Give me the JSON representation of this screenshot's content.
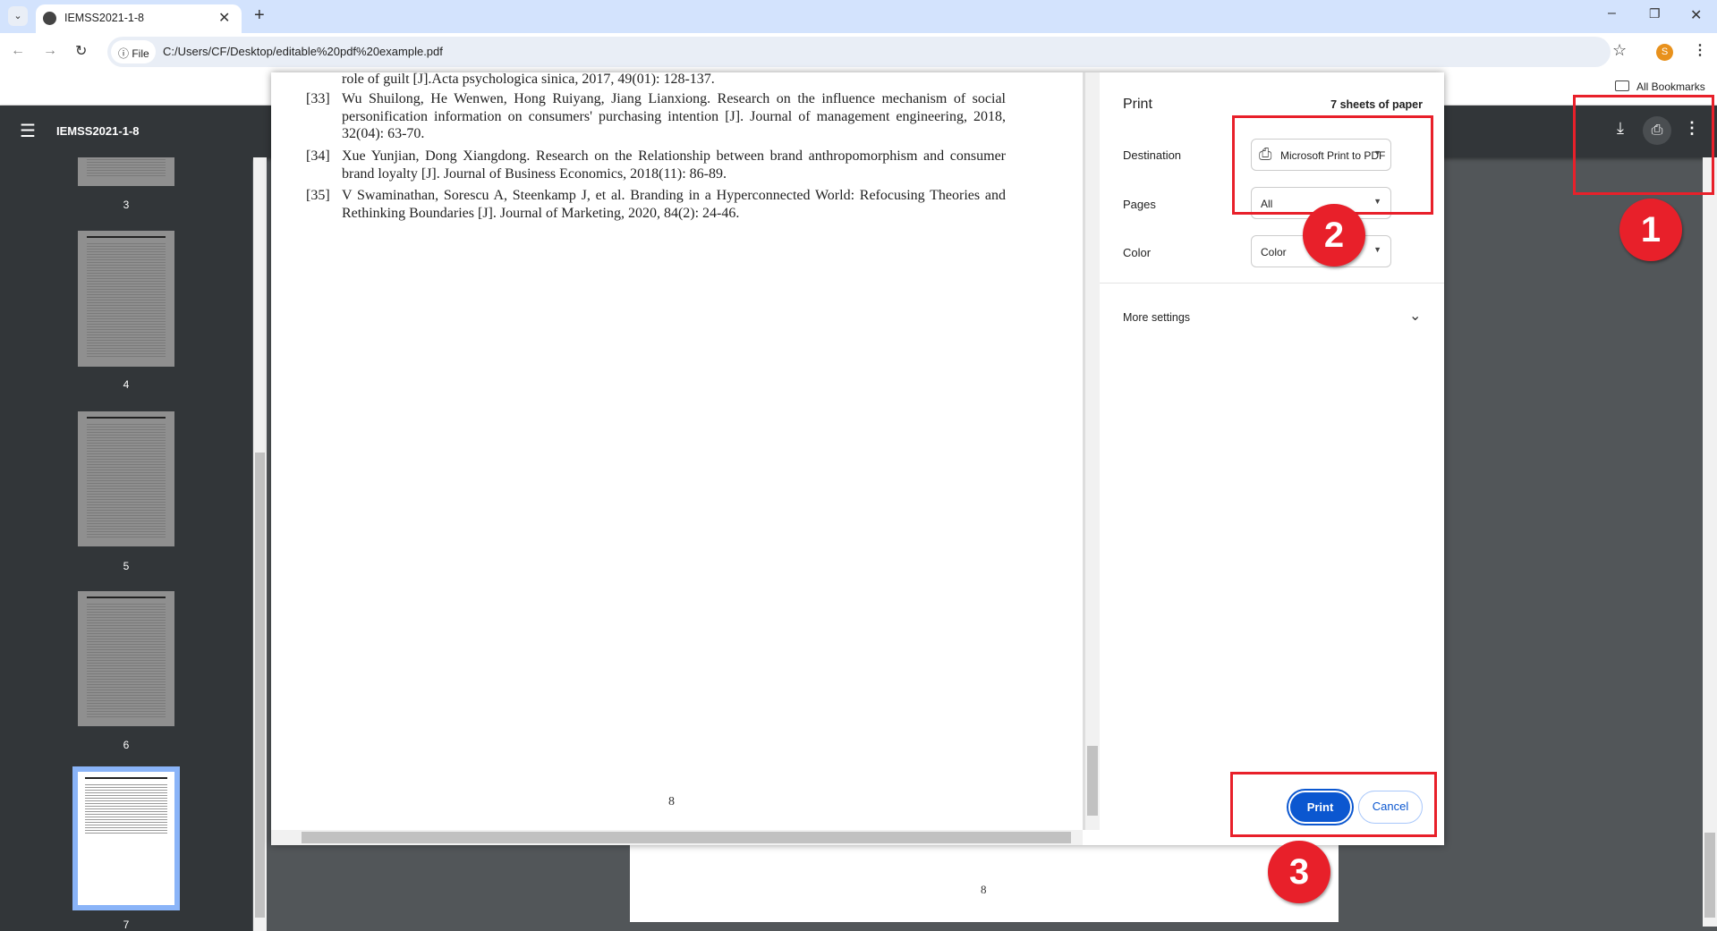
{
  "browser": {
    "tab_title": "IEMSS2021-1-8",
    "url_chip": "File",
    "url": "C:/Users/CF/Desktop/editable%20pdf%20example.pdf",
    "bookmarks_label": "All Bookmarks",
    "profile_initial": "S"
  },
  "viewer": {
    "title": "IEMSS2021-1-8",
    "thumbnails": [
      "3",
      "4",
      "5",
      "6",
      "7"
    ],
    "selected_page": "7",
    "page_number": "8"
  },
  "preview": {
    "references": [
      {
        "num": "",
        "text": "role of guilt [J].Acta psychologica sinica, 2017, 49(01): 128-137."
      },
      {
        "num": "[33]",
        "text": "Wu Shuilong, He Wenwen, Hong Ruiyang, Jiang Lianxiong. Research on the influence mechanism of social personification information on consumers' purchasing intention [J]. Journal of management engineering, 2018, 32(04): 63-70."
      },
      {
        "num": "[34]",
        "text": "Xue Yunjian, Dong Xiangdong. Research on the Relationship between brand anthropomorphism and consumer brand loyalty [J]. Journal of Business Economics, 2018(11): 86-89."
      },
      {
        "num": "[35]",
        "text": "V Swaminathan, Sorescu A, Steenkamp J, et al. Branding in a Hyperconnected World: Refocusing Theories and Rethinking Boundaries [J]. Journal of Marketing, 2020, 84(2): 24-46."
      }
    ],
    "page_number": "8"
  },
  "print": {
    "title": "Print",
    "sheets": "7 sheets of paper",
    "destination_label": "Destination",
    "destination_value": "Microsoft Print to PDF",
    "pages_label": "Pages",
    "pages_value": "All",
    "color_label": "Color",
    "color_value": "Color",
    "more_settings": "More settings",
    "print_button": "Print",
    "cancel_button": "Cancel"
  },
  "annotations": [
    "1",
    "2",
    "3"
  ],
  "colors": {
    "accent": "#0b57d0",
    "annotation": "#e8202a",
    "toolbar": "#323639"
  }
}
